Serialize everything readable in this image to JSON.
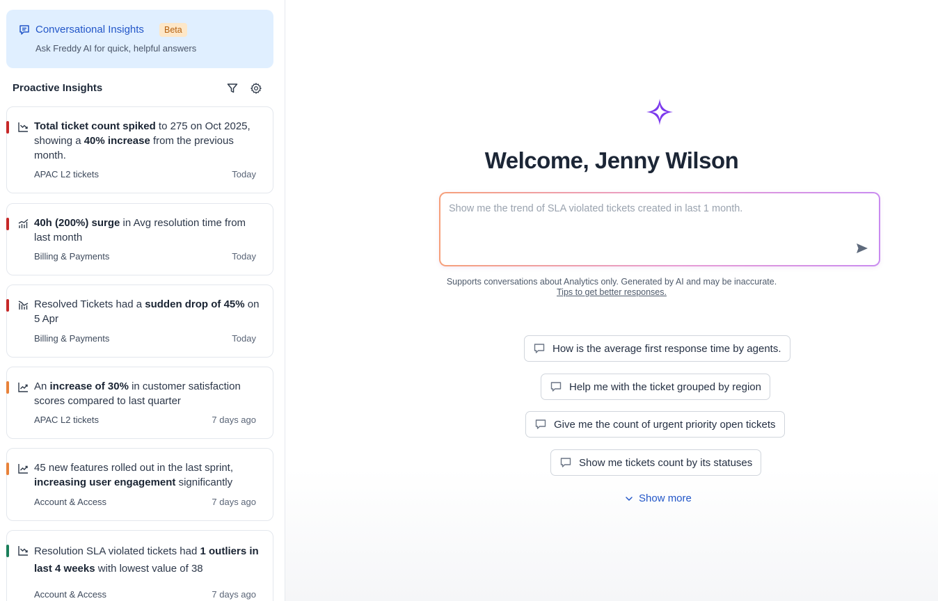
{
  "conversational": {
    "title": "Conversational Insights",
    "badge": "Beta",
    "subtitle": "Ask Freddy AI for quick, helpful answers"
  },
  "proactive": {
    "title": "Proactive Insights",
    "insights": [
      {
        "segments": [
          {
            "t": "Total ticket count spiked",
            "b": true
          },
          {
            "t": " to 275 on Oct 2025, showing a ",
            "b": false
          },
          {
            "t": "40% increase",
            "b": true
          },
          {
            "t": " from the previous month.",
            "b": false
          }
        ],
        "tag": "APAC L2 tickets",
        "time": "Today",
        "color": "#c62828",
        "icon": "trend-down-icon"
      },
      {
        "segments": [
          {
            "t": "40h (200%) surge",
            "b": true
          },
          {
            "t": " in Avg resolution time from last month",
            "b": false
          }
        ],
        "tag": "Billing & Payments",
        "time": "Today",
        "color": "#c62828",
        "icon": "bar-spike-icon"
      },
      {
        "segments": [
          {
            "t": "Resolved Tickets had a ",
            "b": false
          },
          {
            "t": "sudden drop of 45%",
            "b": true
          },
          {
            "t": " on 5 Apr",
            "b": false
          }
        ],
        "tag": "Billing & Payments",
        "time": "Today",
        "color": "#c62828",
        "icon": "bar-drop-icon"
      },
      {
        "segments": [
          {
            "t": "An ",
            "b": false
          },
          {
            "t": "increase of 30%",
            "b": true
          },
          {
            "t": " in customer satisfaction scores compared to last quarter",
            "b": false
          }
        ],
        "tag": "APAC L2 tickets",
        "time": "7 days ago",
        "color": "#e8823a",
        "icon": "trend-up-icon"
      },
      {
        "segments": [
          {
            "t": "45 new features rolled out in the last sprint, ",
            "b": false
          },
          {
            "t": "increasing user engagement",
            "b": true
          },
          {
            "t": " significantly",
            "b": false
          }
        ],
        "tag": "Account & Access",
        "time": "7 days ago",
        "color": "#e8823a",
        "icon": "trend-up-icon"
      },
      {
        "segments": [
          {
            "t": "Resolution SLA violated tickets had ",
            "b": false
          },
          {
            "t": "1 outliers in last 4 weeks",
            "b": true
          },
          {
            "t": " with lowest value of 38",
            "b": false
          }
        ],
        "tag": "Account & Access",
        "time": "7 days ago",
        "color": "#1a7f5a",
        "icon": "trend-down-icon"
      }
    ]
  },
  "main": {
    "welcome": "Welcome, Jenny Wilson",
    "placeholder": "Show me the trend of SLA violated tickets created in last 1 month.",
    "disclaimer": "Supports conversations about Analytics only. Generated by AI and may be inaccurate.",
    "tips": "Tips to get better responses.",
    "suggestions": [
      "How is the average first response time by agents.",
      "Help me with the ticket grouped by region",
      "Give me the count of urgent priority open tickets",
      "Show me tickets count by its statuses"
    ],
    "show_more": "Show more"
  },
  "colors": {
    "accent_blue": "#2256c8",
    "sparkle": "#7c3aed"
  }
}
